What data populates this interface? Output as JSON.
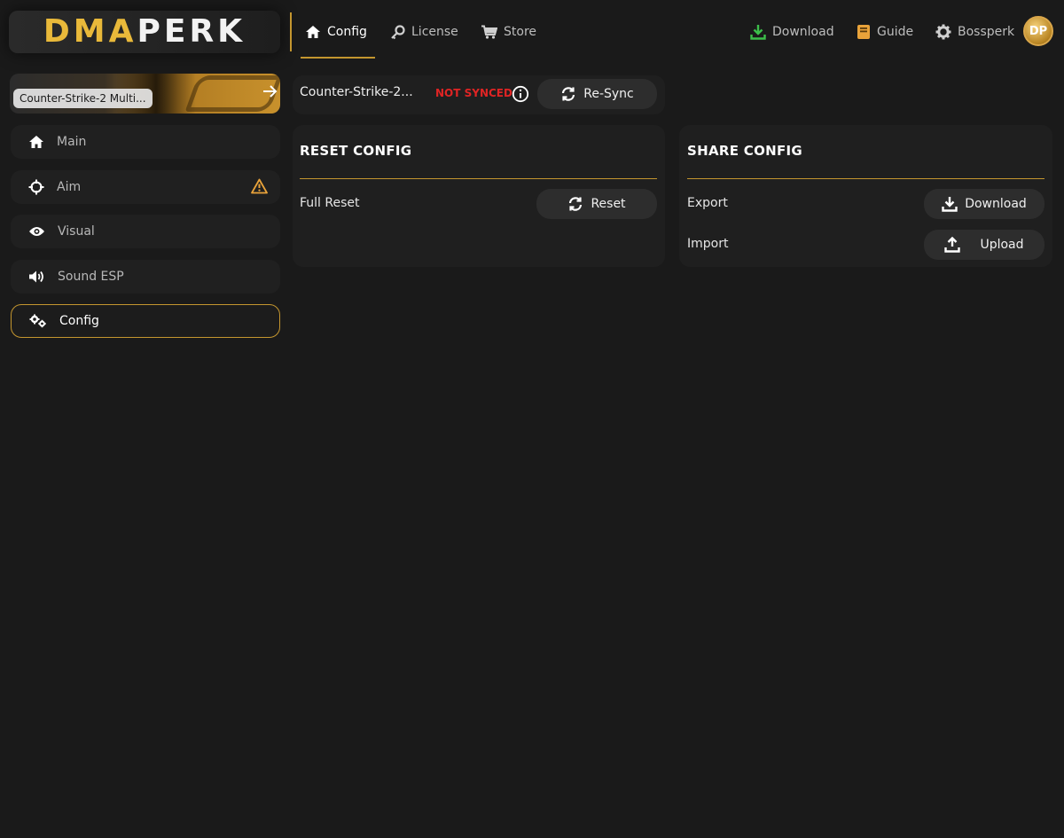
{
  "brand": {
    "part1": "DMA",
    "part2": "PERK"
  },
  "topnav": {
    "config": "Config",
    "license": "License",
    "store": "Store",
    "download": "Download",
    "guide": "Guide",
    "user": "Bossperk",
    "avatar_initials": "DP"
  },
  "sidebar": {
    "game_banner_label": "Counter-Strike-2 Multi...",
    "items": [
      {
        "label": "Main"
      },
      {
        "label": "Aim"
      },
      {
        "label": "Visual"
      },
      {
        "label": "Sound ESP"
      },
      {
        "label": "Config"
      }
    ]
  },
  "sync": {
    "game": "Counter-Strike-2...",
    "status": "NOT SYNCED",
    "resync_label": "Re-Sync"
  },
  "reset_panel": {
    "title": "RESET CONFIG",
    "row_label": "Full Reset",
    "button_label": "Reset"
  },
  "share_panel": {
    "title": "SHARE CONFIG",
    "export_label": "Export",
    "download_label": "Download",
    "import_label": "Import",
    "upload_label": "Upload"
  },
  "colors": {
    "accent": "#c4962f",
    "status_error": "#e02424",
    "download_icon": "#3cbf4a",
    "guide_icon": "#e9a33a"
  }
}
